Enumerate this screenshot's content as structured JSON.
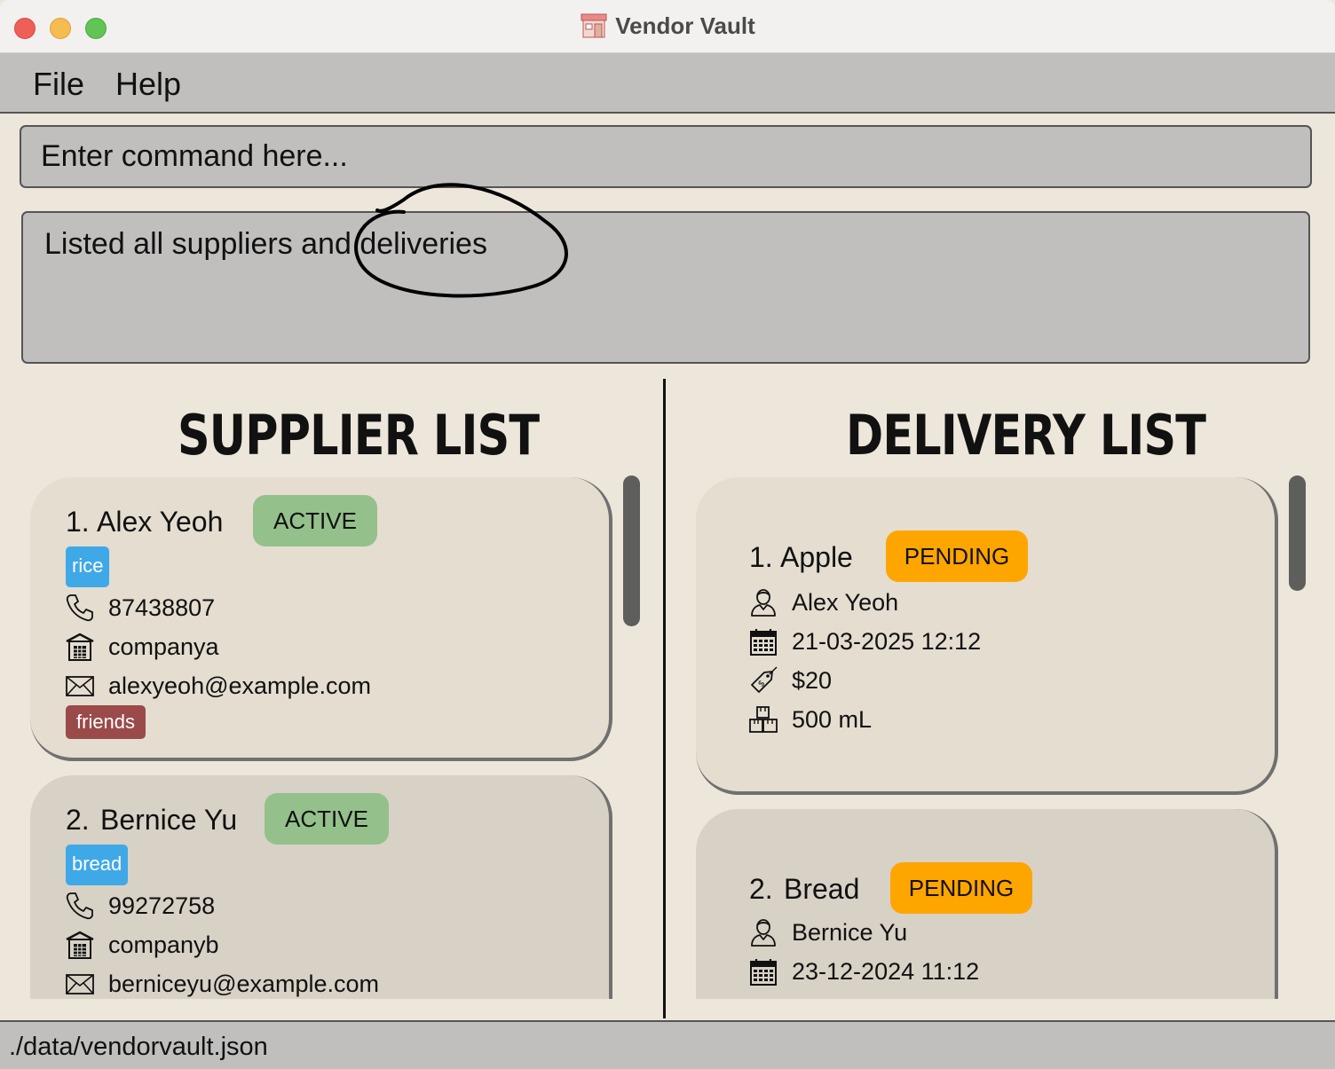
{
  "window": {
    "title": "Vendor Vault"
  },
  "menu": {
    "file": "File",
    "help": "Help"
  },
  "command": {
    "placeholder": "Enter command here..."
  },
  "result": {
    "message": "Listed all suppliers and deliveries"
  },
  "suppliers": {
    "heading": "SUPPLIER LIST",
    "items": [
      {
        "index": "1.",
        "name": "Alex Yeoh",
        "status": "ACTIVE",
        "product_tag": "rice",
        "phone": "87438807",
        "company": "companya",
        "email": "alexyeoh@example.com",
        "group_tag": "friends"
      },
      {
        "index": "2.",
        "name": "Bernice Yu",
        "status": "ACTIVE",
        "product_tag": "bread",
        "phone": "99272758",
        "company": "companyb",
        "email": "berniceyu@example.com"
      }
    ]
  },
  "deliveries": {
    "heading": "DELIVERY LIST",
    "items": [
      {
        "index": "1.",
        "product": "Apple",
        "status": "PENDING",
        "supplier": "Alex Yeoh",
        "datetime": "21-03-2025 12:12",
        "cost": "$20",
        "quantity": "500 mL"
      },
      {
        "index": "2.",
        "product": "Bread",
        "status": "PENDING",
        "supplier": "Bernice Yu",
        "datetime": "23-12-2024 11:12"
      }
    ]
  },
  "statusbar": {
    "path": "./data/vendorvault.json"
  },
  "colors": {
    "background": "#ede6da",
    "panel": "#c0bfbe",
    "active": "#94c08c",
    "pending": "#ffa500",
    "tag_blue": "#3fa9e8",
    "tag_red": "#9b4a4a"
  },
  "icons": [
    "phone-icon",
    "building-icon",
    "mail-icon",
    "person-icon",
    "calendar-icon",
    "price-tag-icon",
    "boxes-icon"
  ]
}
